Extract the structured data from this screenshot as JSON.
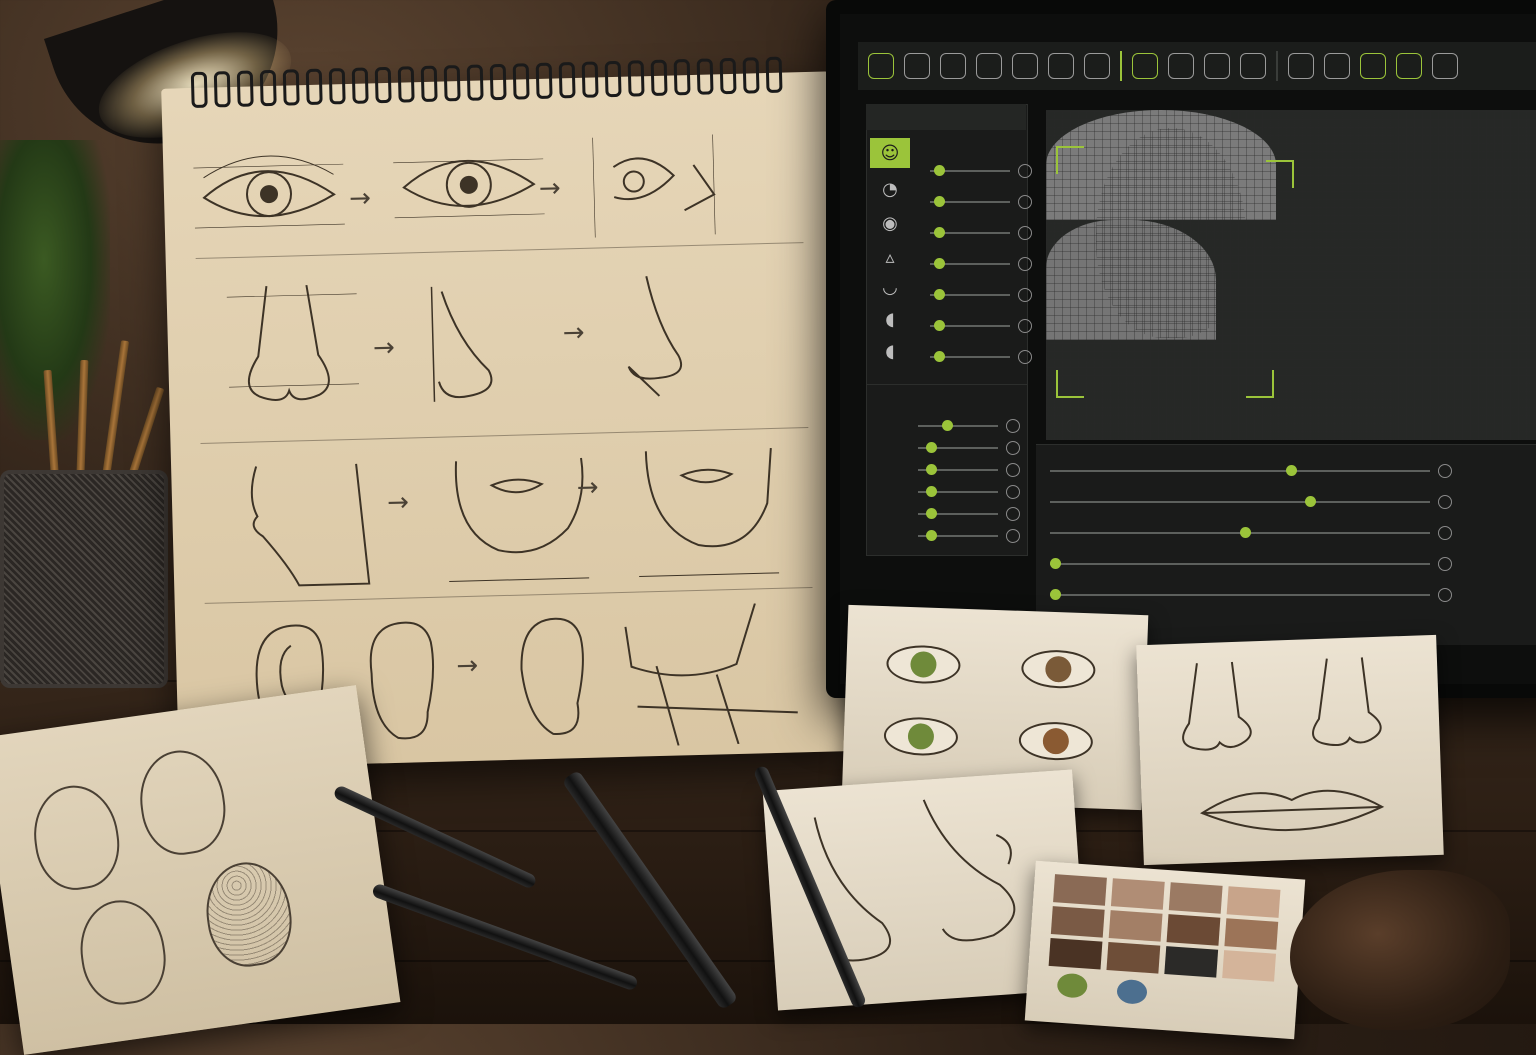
{
  "scene": {
    "description_tags": [
      "sketchbook",
      "monitor",
      "desk",
      "lamp",
      "pencils",
      "reference-papers",
      "color-swatches"
    ]
  },
  "colors": {
    "accent": "#9bc43a",
    "skin_swatches": [
      "#8a6a55",
      "#b08d75",
      "#9b7a63",
      "#c8a48a",
      "#7a5a45",
      "#a37f66",
      "#6b4a35",
      "#9c7458",
      "#4a3324",
      "#6e4e38",
      "#2b2a28",
      "#d4b49a"
    ],
    "eye_colors": [
      "#6f8a3a",
      "#7a5a38",
      "#4c6f8f"
    ]
  },
  "icons": {
    "toolbar": [
      "head-icon",
      "face-icon",
      "face-icon",
      "face-icon",
      "face-icon",
      "face-icon",
      "face-icon",
      "user-icon",
      "target-icon",
      "face-icon",
      "face-icon",
      "face-icon",
      "face-icon",
      "face-icon",
      "face-icon",
      "face-icon"
    ],
    "feature_tabs": [
      "head-icon",
      "head-side-icon",
      "eye-icon",
      "nose-icon",
      "lips-icon",
      "ear-icon",
      "ear-icon"
    ]
  },
  "sliders": {
    "left_panel": [
      0.05,
      0.05,
      0.05,
      0.05,
      0.05,
      0.05,
      0.05
    ],
    "lower_left": [
      0.3,
      0.1,
      0.1,
      0.1,
      0.1,
      0.1
    ],
    "bottom": [
      0.62,
      0.67,
      0.5,
      0.0,
      0.0
    ]
  }
}
